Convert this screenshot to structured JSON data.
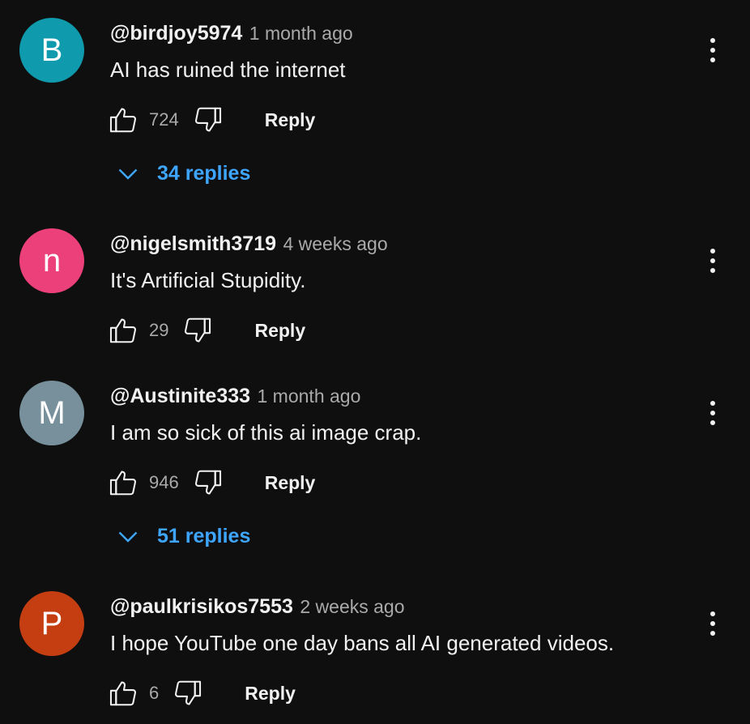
{
  "colors": {
    "background": "#0f0f0f",
    "text": "#f1f1f1",
    "secondary_text": "#aaaaaa",
    "link_blue": "#3ea6ff"
  },
  "comments": [
    {
      "avatar_letter": "B",
      "avatar_color": "#0f9aad",
      "author": "@birdjoy5974",
      "time": "1 month ago",
      "text": "AI has ruined the internet",
      "likes": "724",
      "reply_label": "Reply",
      "replies_label": "34 replies",
      "like_icon": "thumbs-up-icon",
      "dislike_icon": "thumbs-down-icon",
      "menu_icon": "more-vert-icon"
    },
    {
      "avatar_letter": "n",
      "avatar_color": "#ec407a",
      "author": "@nigelsmith3719",
      "time": "4 weeks ago",
      "text": "It's Artificial Stupidity.",
      "likes": "29",
      "reply_label": "Reply",
      "like_icon": "thumbs-up-icon",
      "dislike_icon": "thumbs-down-icon",
      "menu_icon": "more-vert-icon"
    },
    {
      "avatar_letter": "M",
      "avatar_color": "#78909c",
      "author": "@Austinite333",
      "time": "1 month ago",
      "text": "I am so sick of this ai image crap.",
      "likes": "946",
      "reply_label": "Reply",
      "replies_label": "51 replies",
      "like_icon": "thumbs-up-icon",
      "dislike_icon": "thumbs-down-icon",
      "menu_icon": "more-vert-icon"
    },
    {
      "avatar_letter": "P",
      "avatar_color": "#c43e12",
      "author": "@paulkrisikos7553",
      "time": "2 weeks ago",
      "text": "I hope YouTube one day bans all AI generated videos.",
      "likes": "6",
      "reply_label": "Reply",
      "like_icon": "thumbs-up-icon",
      "dislike_icon": "thumbs-down-icon",
      "menu_icon": "more-vert-icon"
    }
  ]
}
